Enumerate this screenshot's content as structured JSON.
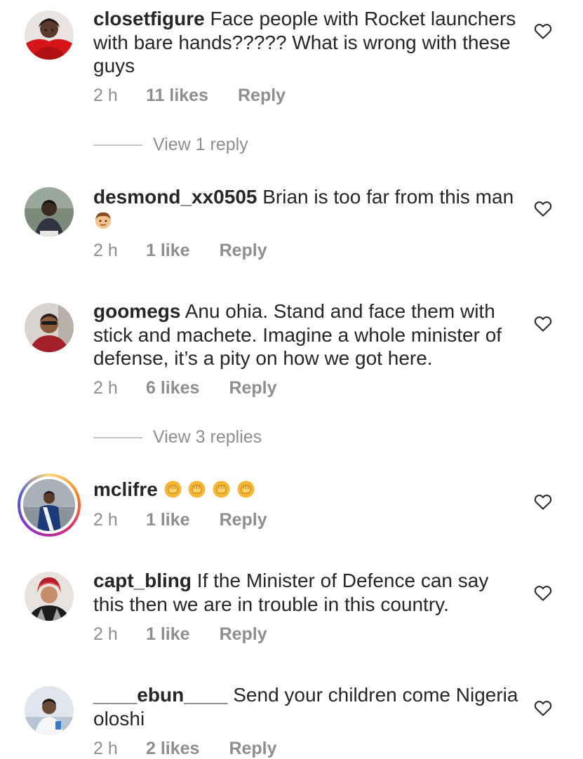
{
  "comments": [
    {
      "username": "closetfigure",
      "text": "Face people with Rocket launchers with bare hands????? What is wrong with these guys",
      "time": "2 h",
      "likes": "11 likes",
      "reply": "Reply",
      "view_replies": "View 1 reply"
    },
    {
      "username": "desmond_xx0505",
      "text": "Brian is too far from this man",
      "emoji": "boy-face-emoji",
      "time": "2 h",
      "likes": "1 like",
      "reply": "Reply"
    },
    {
      "username": "goomegs",
      "text": "Anu ohia. Stand and face them with stick and machete. Imagine a whole minister of defense, it’s a pity on how we got here.",
      "time": "2 h",
      "likes": "6 likes",
      "reply": "Reply",
      "view_replies": "View 3 replies"
    },
    {
      "username": "mclifre",
      "emoji": "raised-fist-emoji x4",
      "time": "2 h",
      "likes": "1 like",
      "reply": "Reply",
      "story_ring": true
    },
    {
      "username": "capt_bling",
      "text": "If the Minister of Defence can say this then we are in trouble in this country.",
      "time": "2 h",
      "likes": "1 like",
      "reply": "Reply"
    },
    {
      "username": "____ebun____",
      "text": "Send your children come Nigeria oloshi",
      "time": "2 h",
      "likes": "2 likes",
      "reply": "Reply"
    }
  ],
  "colors": {
    "text": "#262626",
    "secondary": "#8e8e8e",
    "divider": "#c7c7c7",
    "background": "#ffffff"
  },
  "icons": {
    "like": "heart-outline-icon"
  }
}
